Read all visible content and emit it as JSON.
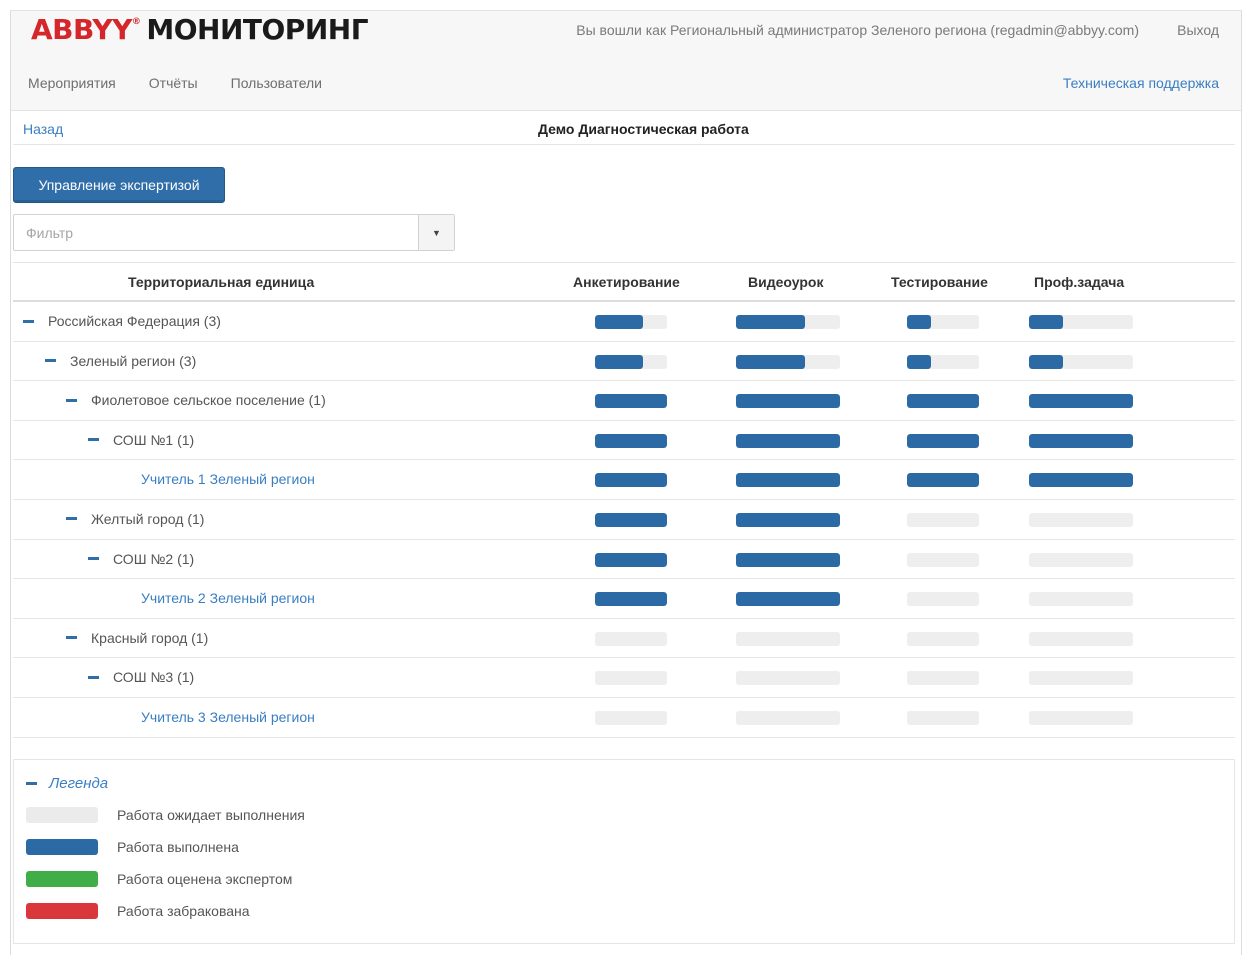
{
  "header": {
    "brand": "ABBYY",
    "reg": "®",
    "product": "МОНИТОРИНГ",
    "user_info": "Вы вошли как Региональный администратор Зеленого региона (regadmin@abbyy.com)",
    "logout": "Выход",
    "nav": [
      "Мероприятия",
      "Отчёты",
      "Пользователи"
    ],
    "support": "Техническая поддержка"
  },
  "breadcrumb": {
    "back": "Назад",
    "title": "Демо Диагностическая работа"
  },
  "controls": {
    "manage_button": "Управление экспертизой",
    "filter_placeholder": "Фильтр",
    "dropdown_icon": "▼"
  },
  "table": {
    "columns": [
      "Территориальная единица",
      "Анкетирование",
      "Видеоурок",
      "Тестирование",
      "Проф.задача"
    ],
    "rows": [
      {
        "label": "Российская Федерация (3)",
        "level": 0,
        "link": false,
        "progress": [
          0.66,
          0.66,
          0.33,
          0.33
        ]
      },
      {
        "label": "Зеленый регион (3)",
        "level": 1,
        "link": false,
        "progress": [
          0.66,
          0.66,
          0.33,
          0.33
        ]
      },
      {
        "label": "Фиолетовое сельское поселение (1)",
        "level": 2,
        "link": false,
        "progress": [
          1,
          1,
          1,
          1
        ]
      },
      {
        "label": "СОШ №1   (1)",
        "level": 3,
        "link": false,
        "progress": [
          1,
          1,
          1,
          1
        ]
      },
      {
        "label": "Учитель 1 Зеленый регион",
        "level": 4,
        "link": true,
        "progress": [
          1,
          1,
          1,
          1
        ]
      },
      {
        "label": "Желтый город (1)",
        "level": 2,
        "link": false,
        "progress": [
          1,
          1,
          0,
          0
        ]
      },
      {
        "label": "СОШ №2 (1)",
        "level": 3,
        "link": false,
        "progress": [
          1,
          1,
          0,
          0
        ]
      },
      {
        "label": "Учитель 2 Зеленый регион",
        "level": 4,
        "link": true,
        "progress": [
          1,
          1,
          0,
          0
        ]
      },
      {
        "label": "Красный город (1)",
        "level": 2,
        "link": false,
        "progress": [
          0,
          0,
          0,
          0
        ]
      },
      {
        "label": "СОШ №3 (1)",
        "level": 3,
        "link": false,
        "progress": [
          0,
          0,
          0,
          0
        ]
      },
      {
        "label": "Учитель 3 Зеленый регион",
        "level": 4,
        "link": true,
        "progress": [
          0,
          0,
          0,
          0
        ]
      }
    ]
  },
  "legend": {
    "title": "Легенда",
    "items": [
      {
        "label": "Работа ожидает выполнения",
        "color": "#ebebeb"
      },
      {
        "label": "Работа выполнена",
        "color": "#2c6aa6"
      },
      {
        "label": "Работа оценена экспертом",
        "color": "#3fae48"
      },
      {
        "label": "Работа забракована",
        "color": "#d9373c"
      }
    ]
  },
  "colors": {
    "accent": "#2f6ea8",
    "link": "#3a7ec2",
    "brand_red": "#d4262b"
  }
}
